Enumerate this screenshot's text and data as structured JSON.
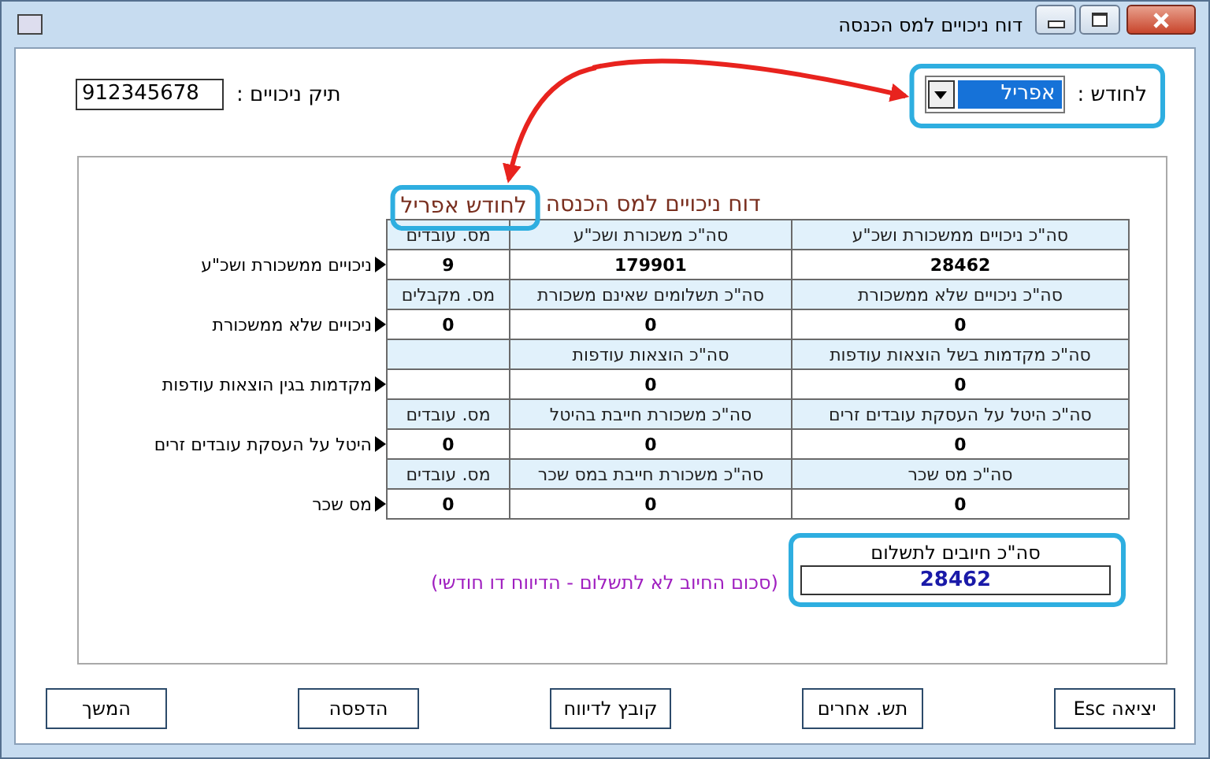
{
  "window": {
    "title": "דוח ניכויים למס הכנסה"
  },
  "month": {
    "label": "לחודש :",
    "value": "אפריל"
  },
  "file": {
    "label": "תיק ניכויים :",
    "value": "912345678"
  },
  "report": {
    "title": "דוח ניכויים למס הכנסה",
    "title_month": "לחודש אפריל",
    "groups": [
      {
        "label": "ניכויים ממשכורת ושכ\"ע",
        "cells": [
          {
            "header": "סה\"כ ניכויים ממשכורת ושכ\"ע",
            "value": "28462"
          },
          {
            "header": "סה\"כ משכורת ושכ\"ע",
            "value": "179901"
          },
          {
            "header": "מס. עובדים",
            "value": "9"
          }
        ]
      },
      {
        "label": "ניכויים שלא ממשכורת",
        "cells": [
          {
            "header": "סה\"כ ניכויים שלא ממשכורת",
            "value": "0"
          },
          {
            "header": "סה\"כ תשלומים שאינם משכורת",
            "value": "0"
          },
          {
            "header": "מס. מקבלים",
            "value": "0"
          }
        ]
      },
      {
        "label": "מקדמות בגין הוצאות עודפות",
        "cells": [
          {
            "header": "סה\"כ מקדמות בשל הוצאות עודפות",
            "value": "0"
          },
          {
            "header": "סה\"כ הוצאות עודפות",
            "value": "0"
          }
        ]
      },
      {
        "label": "היטל על העסקת עובדים זרים",
        "cells": [
          {
            "header": "סה\"כ היטל על העסקת עובדים זרים",
            "value": "0"
          },
          {
            "header": "סה\"כ משכורת חייבת בהיטל",
            "value": "0"
          },
          {
            "header": "מס. עובדים",
            "value": "0"
          }
        ]
      },
      {
        "label": "מס שכר",
        "cells": [
          {
            "header": "סה\"כ מס שכר",
            "value": "0"
          },
          {
            "header": "סה\"כ משכורת חייבת במס שכר",
            "value": "0"
          },
          {
            "header": "מס. עובדים",
            "value": "0"
          }
        ]
      }
    ],
    "total": {
      "label": "סה\"כ חיובים לתשלום",
      "value": "28462"
    },
    "note": "(סכום החיוב לא לתשלום - הדיווח דו חודשי)"
  },
  "buttons": [
    "יציאה Esc",
    "תש. אחרים",
    "קובץ לדיווח",
    "הדפסה",
    "המשך"
  ]
}
